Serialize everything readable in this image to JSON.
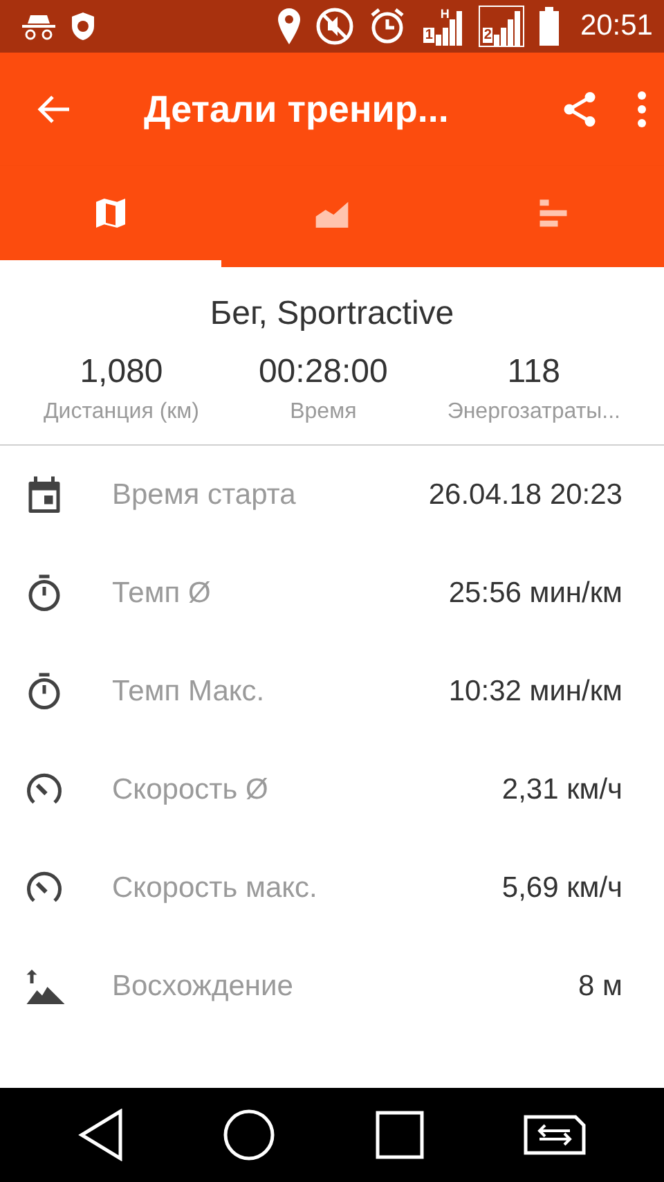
{
  "status_bar": {
    "time": "20:51",
    "sims": [
      {
        "label": "1",
        "network": "H"
      },
      {
        "label": "2"
      }
    ]
  },
  "app_bar": {
    "title": "Детали тренир..."
  },
  "tabs": [
    {
      "kind": "map",
      "selected": true
    },
    {
      "kind": "chart",
      "selected": false
    },
    {
      "kind": "bars",
      "selected": false
    }
  ],
  "summary": {
    "title": "Бег, Sportractive",
    "stats": [
      {
        "value": "1,080",
        "label": "Дистанция (км)"
      },
      {
        "value": "00:28:00",
        "label": "Время"
      },
      {
        "value": "118",
        "label": "Энергозатраты..."
      }
    ]
  },
  "details": [
    {
      "kind": "calendar",
      "label": "Время старта",
      "value": "26.04.18 20:23"
    },
    {
      "kind": "stopwatch",
      "label": "Темп Ø",
      "value": "25:56 мин/км"
    },
    {
      "kind": "stopwatch",
      "label": "Темп Макс.",
      "value": "10:32 мин/км"
    },
    {
      "kind": "speed",
      "label": "Скорость Ø",
      "value": "2,31 км/ч"
    },
    {
      "kind": "speed",
      "label": "Скорость макс.",
      "value": "5,69 км/ч"
    },
    {
      "kind": "climb",
      "label": "Восхождение",
      "value": "8 м"
    }
  ]
}
